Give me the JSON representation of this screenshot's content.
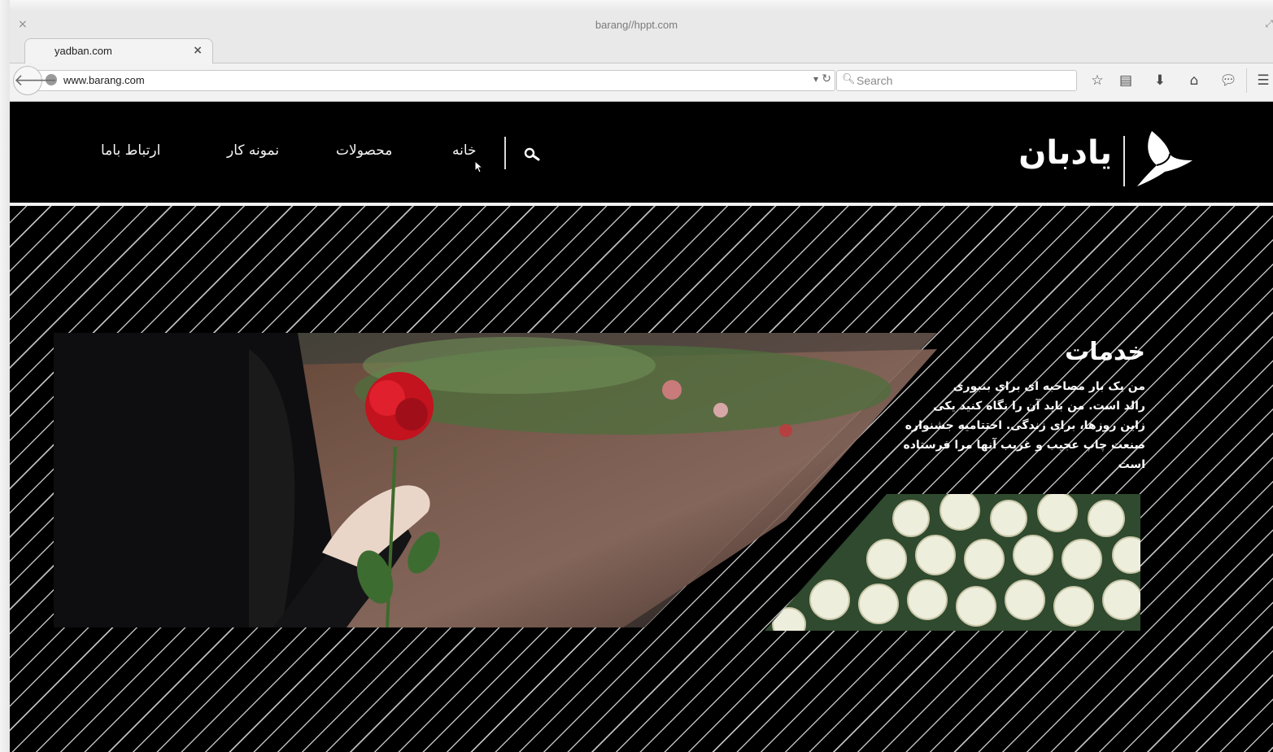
{
  "window": {
    "title": "barang//hppt.com",
    "close_glyph": "×"
  },
  "tab": {
    "title": "yadban.com",
    "close_glyph": "×"
  },
  "navbar": {
    "url": "www.barang.com",
    "search_placeholder": "Search",
    "icons": [
      "back-arrow-icon",
      "site-identity-icon",
      "dropdown-icon",
      "reload-icon",
      "search-icon",
      "bookmark-star-icon",
      "reading-list-icon",
      "download-icon",
      "home-icon",
      "chat-icon",
      "menu-icon"
    ]
  },
  "site": {
    "logo_text": "یادبان",
    "nav": {
      "home": "خانه",
      "products": "محصولات",
      "portfolio": "نمونه کار",
      "contact": "ارتباط باما"
    },
    "services": {
      "title": "خدمات",
      "lines": [
        "من یک بار مصاحبه ای برای بنبوری",
        "رالد است. من باید آن را نگاه کنید یکی",
        "زاین روزها، برای زندگی. اختتامیه جشنواره",
        "صنعت چاپ عجیب و غریب آنها مرا فرستاده است"
      ]
    }
  },
  "colors": {
    "chrome_bg": "#e9e9e9",
    "page_bg": "#000000",
    "stripe": "#bcbcbc",
    "text_light": "#ffffff"
  }
}
